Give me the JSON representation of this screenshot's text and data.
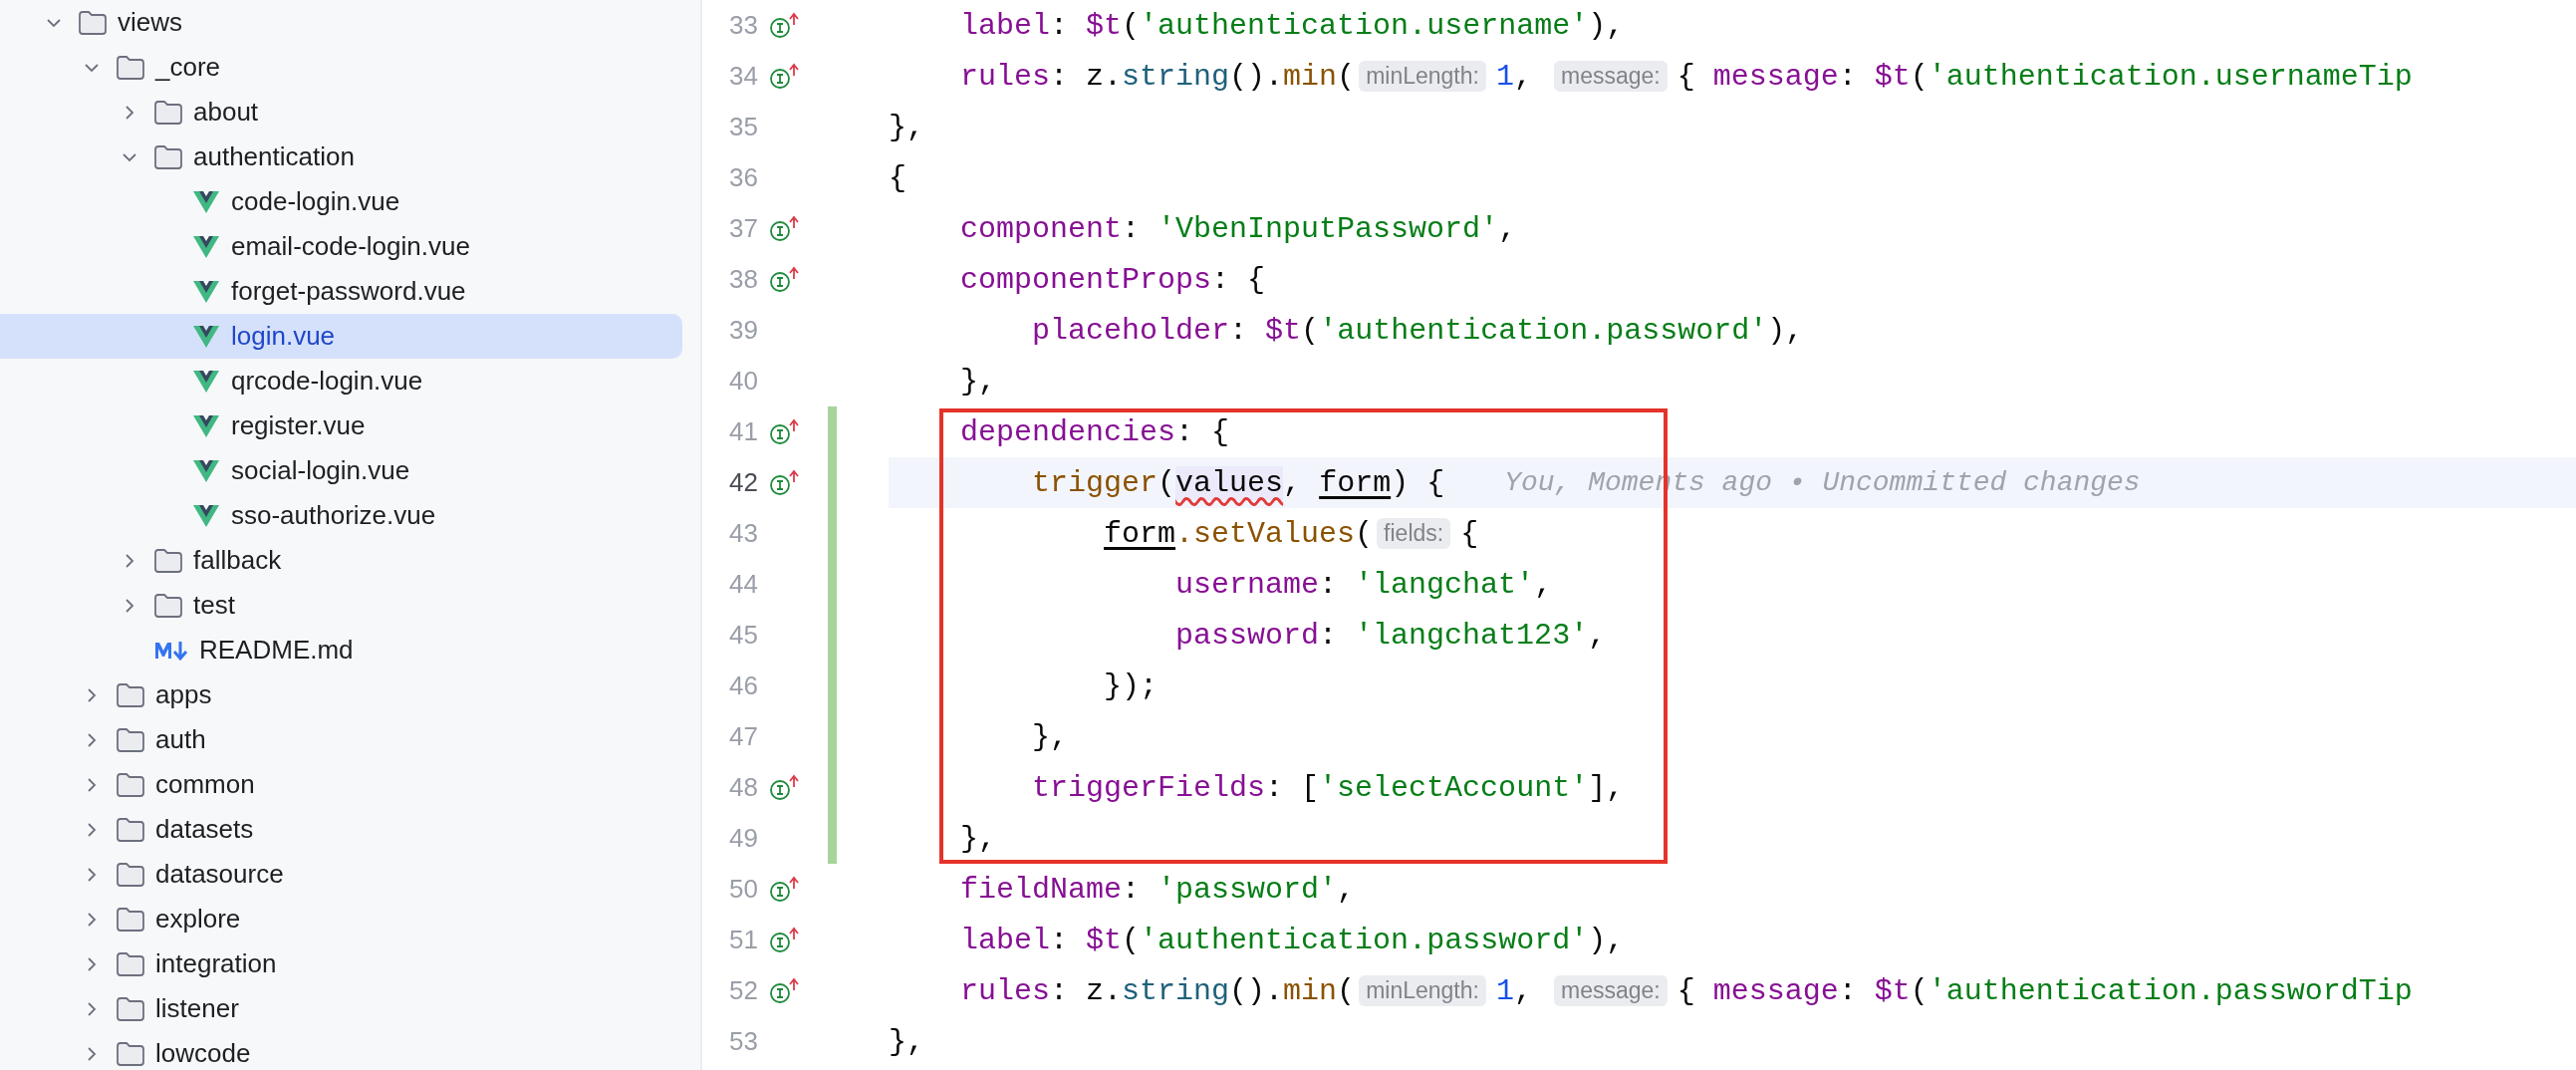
{
  "tree": [
    {
      "name": "views",
      "kind": "folder",
      "expanded": true,
      "selected": false,
      "children": [
        {
          "name": "_core",
          "kind": "folder",
          "expanded": true,
          "selected": false,
          "children": [
            {
              "name": "about",
              "kind": "folder",
              "expanded": false,
              "selected": false
            },
            {
              "name": "authentication",
              "kind": "folder",
              "expanded": true,
              "selected": false,
              "children": [
                {
                  "name": "code-login.vue",
                  "kind": "vue",
                  "selected": false
                },
                {
                  "name": "email-code-login.vue",
                  "kind": "vue",
                  "selected": false
                },
                {
                  "name": "forget-password.vue",
                  "kind": "vue",
                  "selected": false
                },
                {
                  "name": "login.vue",
                  "kind": "vue",
                  "selected": true
                },
                {
                  "name": "qrcode-login.vue",
                  "kind": "vue",
                  "selected": false
                },
                {
                  "name": "register.vue",
                  "kind": "vue",
                  "selected": false
                },
                {
                  "name": "social-login.vue",
                  "kind": "vue",
                  "selected": false
                },
                {
                  "name": "sso-authorize.vue",
                  "kind": "vue",
                  "selected": false
                }
              ]
            },
            {
              "name": "fallback",
              "kind": "folder",
              "expanded": false,
              "selected": false
            },
            {
              "name": "test",
              "kind": "folder",
              "expanded": false,
              "selected": false
            },
            {
              "name": "README.md",
              "kind": "markdown",
              "selected": false
            }
          ]
        },
        {
          "name": "apps",
          "kind": "folder",
          "expanded": false,
          "selected": false
        },
        {
          "name": "auth",
          "kind": "folder",
          "expanded": false,
          "selected": false
        },
        {
          "name": "common",
          "kind": "folder",
          "expanded": false,
          "selected": false
        },
        {
          "name": "datasets",
          "kind": "folder",
          "expanded": false,
          "selected": false
        },
        {
          "name": "datasource",
          "kind": "folder",
          "expanded": false,
          "selected": false
        },
        {
          "name": "explore",
          "kind": "folder",
          "expanded": false,
          "selected": false
        },
        {
          "name": "integration",
          "kind": "folder",
          "expanded": false,
          "selected": false
        },
        {
          "name": "listener",
          "kind": "folder",
          "expanded": false,
          "selected": false
        },
        {
          "name": "lowcode",
          "kind": "folder",
          "expanded": false,
          "selected": false
        }
      ]
    }
  ],
  "editor": {
    "lines": [
      {
        "number": "33",
        "marker": true,
        "changed": false,
        "current": false,
        "boxed": false,
        "tokens": [
          {
            "kind": "prop",
            "text": "    label"
          },
          {
            "kind": "plain",
            "text": ": "
          },
          {
            "kind": "prop",
            "text": "$t"
          },
          {
            "kind": "plain",
            "text": "("
          },
          {
            "kind": "str",
            "text": "'authentication.username'"
          },
          {
            "kind": "plain",
            "text": "),"
          }
        ]
      },
      {
        "number": "34",
        "marker": true,
        "changed": false,
        "current": false,
        "boxed": false,
        "tokens": [
          {
            "kind": "prop",
            "text": "    rules"
          },
          {
            "kind": "plain",
            "text": ": z."
          },
          {
            "kind": "method",
            "text": "string"
          },
          {
            "kind": "plain",
            "text": "()."
          },
          {
            "kind": "fn",
            "text": "min"
          },
          {
            "kind": "plain",
            "text": "("
          },
          {
            "kind": "hint",
            "text": "minLength:"
          },
          {
            "kind": "num",
            "text": "1"
          },
          {
            "kind": "plain",
            "text": ", "
          },
          {
            "kind": "hint",
            "text": "message:"
          },
          {
            "kind": "plain",
            "text": "{ "
          },
          {
            "kind": "prop",
            "text": "message"
          },
          {
            "kind": "plain",
            "text": ": "
          },
          {
            "kind": "prop",
            "text": "$t"
          },
          {
            "kind": "plain",
            "text": "("
          },
          {
            "kind": "str",
            "text": "'authentication.usernameTip"
          }
        ]
      },
      {
        "number": "35",
        "marker": false,
        "changed": false,
        "current": false,
        "boxed": false,
        "tokens": [
          {
            "kind": "plain",
            "text": "},"
          }
        ]
      },
      {
        "number": "36",
        "marker": false,
        "changed": false,
        "current": false,
        "boxed": false,
        "tokens": [
          {
            "kind": "plain",
            "text": "{"
          }
        ]
      },
      {
        "number": "37",
        "marker": true,
        "changed": false,
        "current": false,
        "boxed": false,
        "tokens": [
          {
            "kind": "prop",
            "text": "    component"
          },
          {
            "kind": "plain",
            "text": ": "
          },
          {
            "kind": "str",
            "text": "'VbenInputPassword'"
          },
          {
            "kind": "plain",
            "text": ","
          }
        ]
      },
      {
        "number": "38",
        "marker": true,
        "changed": false,
        "current": false,
        "boxed": false,
        "tokens": [
          {
            "kind": "prop",
            "text": "    componentProps"
          },
          {
            "kind": "plain",
            "text": ": {"
          }
        ]
      },
      {
        "number": "39",
        "marker": false,
        "changed": false,
        "current": false,
        "boxed": false,
        "tokens": [
          {
            "kind": "prop",
            "text": "        placeholder"
          },
          {
            "kind": "plain",
            "text": ": "
          },
          {
            "kind": "prop",
            "text": "$t"
          },
          {
            "kind": "plain",
            "text": "("
          },
          {
            "kind": "str",
            "text": "'authentication.password'"
          },
          {
            "kind": "plain",
            "text": "),"
          }
        ]
      },
      {
        "number": "40",
        "marker": false,
        "changed": false,
        "current": false,
        "boxed": false,
        "tokens": [
          {
            "kind": "plain",
            "text": "    },"
          }
        ]
      },
      {
        "number": "41",
        "marker": true,
        "changed": true,
        "current": false,
        "boxed": true,
        "tokens": [
          {
            "kind": "prop",
            "text": "    dependencies"
          },
          {
            "kind": "plain",
            "text": ": {"
          }
        ]
      },
      {
        "number": "42",
        "marker": true,
        "changed": true,
        "current": true,
        "boxed": true,
        "blame": "You, Moments ago • Uncommitted changes",
        "tokens": [
          {
            "kind": "fn",
            "text": "        trigger"
          },
          {
            "kind": "plain",
            "text": "("
          },
          {
            "kind": "warn",
            "text": "values"
          },
          {
            "kind": "plain",
            "text": ", "
          },
          {
            "kind": "underline",
            "text": "form"
          },
          {
            "kind": "plain",
            "text": ") {"
          }
        ]
      },
      {
        "number": "43",
        "marker": false,
        "changed": true,
        "current": false,
        "boxed": true,
        "tokens": [
          {
            "kind": "underline",
            "text": "            form"
          },
          {
            "kind": "fn",
            "text": ".setValues"
          },
          {
            "kind": "plain",
            "text": "("
          },
          {
            "kind": "hint",
            "text": "fields:"
          },
          {
            "kind": "plain",
            "text": "{"
          }
        ]
      },
      {
        "number": "44",
        "marker": false,
        "changed": true,
        "current": false,
        "boxed": true,
        "tokens": [
          {
            "kind": "prop",
            "text": "                username"
          },
          {
            "kind": "plain",
            "text": ": "
          },
          {
            "kind": "str",
            "text": "'langchat'"
          },
          {
            "kind": "plain",
            "text": ","
          }
        ]
      },
      {
        "number": "45",
        "marker": false,
        "changed": true,
        "current": false,
        "boxed": true,
        "tokens": [
          {
            "kind": "prop",
            "text": "                password"
          },
          {
            "kind": "plain",
            "text": ": "
          },
          {
            "kind": "str",
            "text": "'langchat123'"
          },
          {
            "kind": "plain",
            "text": ","
          }
        ]
      },
      {
        "number": "46",
        "marker": false,
        "changed": true,
        "current": false,
        "boxed": true,
        "tokens": [
          {
            "kind": "plain",
            "text": "            });"
          }
        ]
      },
      {
        "number": "47",
        "marker": false,
        "changed": true,
        "current": false,
        "boxed": true,
        "tokens": [
          {
            "kind": "plain",
            "text": "        },"
          }
        ]
      },
      {
        "number": "48",
        "marker": true,
        "changed": true,
        "current": false,
        "boxed": true,
        "tokens": [
          {
            "kind": "prop",
            "text": "        triggerFields"
          },
          {
            "kind": "plain",
            "text": ": ["
          },
          {
            "kind": "str",
            "text": "'selectAccount'"
          },
          {
            "kind": "plain",
            "text": "],"
          }
        ]
      },
      {
        "number": "49",
        "marker": false,
        "changed": true,
        "current": false,
        "boxed": true,
        "tokens": [
          {
            "kind": "plain",
            "text": "    },"
          }
        ]
      },
      {
        "number": "50",
        "marker": true,
        "changed": false,
        "current": false,
        "boxed": false,
        "tokens": [
          {
            "kind": "prop",
            "text": "    fieldName"
          },
          {
            "kind": "plain",
            "text": ": "
          },
          {
            "kind": "str",
            "text": "'password'"
          },
          {
            "kind": "plain",
            "text": ","
          }
        ]
      },
      {
        "number": "51",
        "marker": true,
        "changed": false,
        "current": false,
        "boxed": false,
        "tokens": [
          {
            "kind": "prop",
            "text": "    label"
          },
          {
            "kind": "plain",
            "text": ": "
          },
          {
            "kind": "prop",
            "text": "$t"
          },
          {
            "kind": "plain",
            "text": "("
          },
          {
            "kind": "str",
            "text": "'authentication.password'"
          },
          {
            "kind": "plain",
            "text": "),"
          }
        ]
      },
      {
        "number": "52",
        "marker": true,
        "changed": false,
        "current": false,
        "boxed": false,
        "tokens": [
          {
            "kind": "prop",
            "text": "    rules"
          },
          {
            "kind": "plain",
            "text": ": z."
          },
          {
            "kind": "method",
            "text": "string"
          },
          {
            "kind": "plain",
            "text": "()."
          },
          {
            "kind": "fn",
            "text": "min"
          },
          {
            "kind": "plain",
            "text": "("
          },
          {
            "kind": "hint",
            "text": "minLength:"
          },
          {
            "kind": "num",
            "text": "1"
          },
          {
            "kind": "plain",
            "text": ", "
          },
          {
            "kind": "hint",
            "text": "message:"
          },
          {
            "kind": "plain",
            "text": "{ "
          },
          {
            "kind": "prop",
            "text": "message"
          },
          {
            "kind": "plain",
            "text": ": "
          },
          {
            "kind": "prop",
            "text": "$t"
          },
          {
            "kind": "plain",
            "text": "("
          },
          {
            "kind": "str",
            "text": "'authentication.passwordTip"
          }
        ]
      },
      {
        "number": "53",
        "marker": false,
        "changed": false,
        "current": false,
        "boxed": false,
        "tokens": [
          {
            "kind": "plain",
            "text": "},"
          }
        ]
      }
    ]
  }
}
